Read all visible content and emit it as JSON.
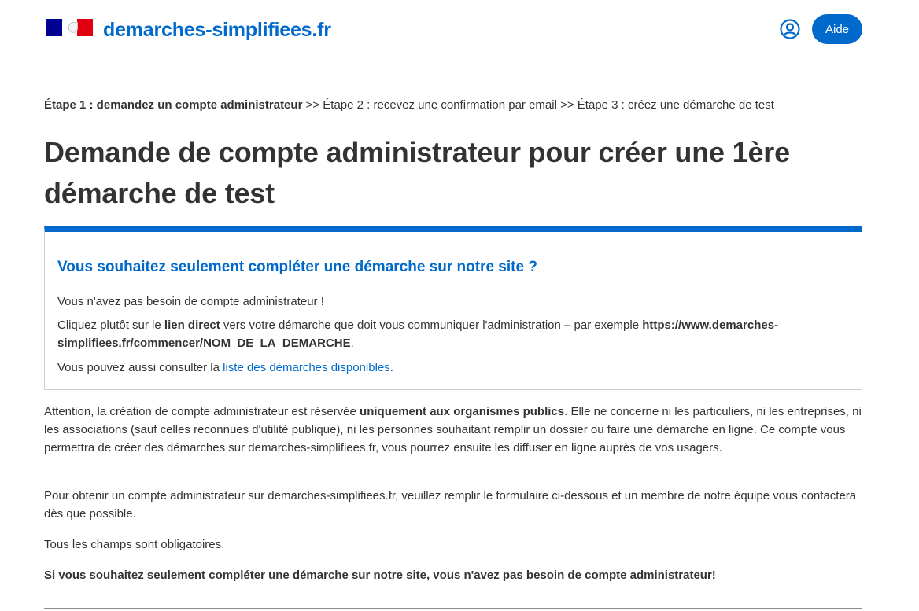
{
  "header": {
    "site_name": "demarches-simplifiees.fr",
    "help_button": "Aide",
    "user_icon": "user-circle-icon",
    "logo": "republique-francaise-logo"
  },
  "steps": {
    "step1": "Étape 1 : demandez un compte administrateur",
    "separator1": " >> ",
    "step2": "Étape 2 : recevez une confirmation par email",
    "separator2": " >> ",
    "step3": "Étape 3 : créez une démarche de test"
  },
  "page_title": "Demande de compte administrateur pour créer une 1ère démarche de test",
  "notice": {
    "title": "Vous souhaitez seulement compléter une démarche sur notre site ?",
    "line1": "Vous n'avez pas besoin de compte administrateur !",
    "line2_a": "Cliquez plutôt sur le ",
    "line2_b": "lien direct",
    "line2_c": " vers votre démarche que doit vous communiquer l'administration – par exemple ",
    "line2_d": "https://www.demarches-simplifiees.fr/commencer/NOM_DE_LA_DEMARCHE",
    "line2_e": ".",
    "line3_a": "Vous pouvez aussi consulter la ",
    "line3_link": "liste des démarches disponibles",
    "line3_c": "."
  },
  "body": {
    "p1_a": "Attention, la création de compte administrateur est réservée ",
    "p1_b": "uniquement aux organismes publics",
    "p1_c": ". Elle ne concerne ni les particuliers, ni les entreprises, ni les associations (sauf celles reconnues d'utilité publique), ni les personnes souhaitant remplir un dossier ou faire une démarche en ligne. Ce compte vous permettra de créer des démarches sur demarches-simplifiees.fr, vous pourrez ensuite les diffuser en ligne auprès de vos usagers.",
    "p2": "Pour obtenir un compte administrateur sur demarches-simplifiees.fr, veuillez remplir le formulaire ci-dessous et un membre de notre équipe vous contactera dès que possible.",
    "p3": "Tous les champs sont obligatoires.",
    "p4": "Si vous souhaitez seulement compléter une démarche sur notre site, vous n'avez pas besoin de compte administrateur!"
  },
  "colors": {
    "accent": "#0069cc",
    "text": "#333333",
    "marianne_blue": "#000091",
    "marianne_red": "#e1000f"
  }
}
